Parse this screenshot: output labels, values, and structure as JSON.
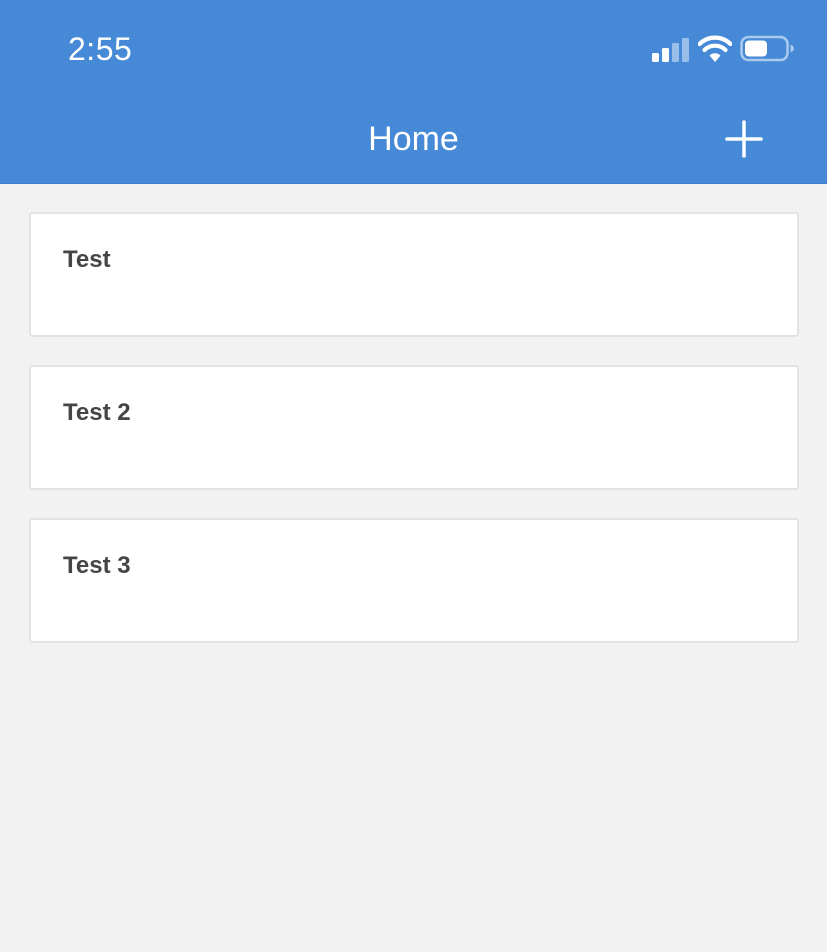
{
  "status_bar": {
    "time": "2:55",
    "icons": [
      "signal-icon",
      "wifi-icon",
      "battery-icon"
    ]
  },
  "nav": {
    "title": "Home",
    "add_icon": "plus-icon"
  },
  "items": [
    {
      "title": "Test"
    },
    {
      "title": "Test 2"
    },
    {
      "title": "Test 3"
    }
  ],
  "colors": {
    "header": "#4589d7",
    "background": "#f2f2f2",
    "card": "#ffffff",
    "card_border": "#e3e3e3",
    "card_text": "#454545"
  }
}
